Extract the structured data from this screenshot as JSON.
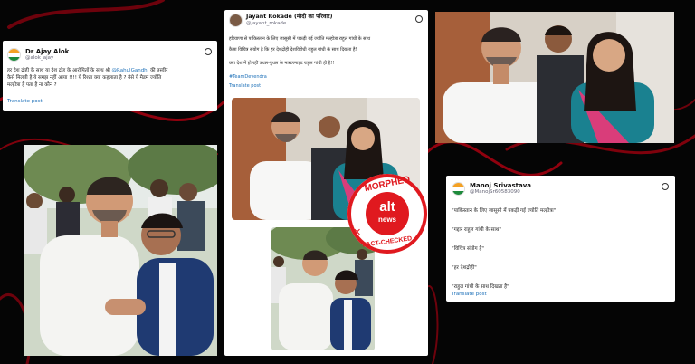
{
  "colors": {
    "background": "#050505",
    "swirl": "#b30010",
    "link": "#1d70b8",
    "stamp_red": "#e0191f",
    "saffron": "#f4a124",
    "india_green": "#1e8a3c"
  },
  "tweet_alok": {
    "name": "Dr Ajay Alok",
    "handle": "@alok_ajay",
    "text_line1_before": "हर देश द्रोही के साथ या देश द्रोह के आरोपितों के साथ श्री ",
    "mention": "@RahulGandhi",
    "text_line1_after": " की तस्वीर",
    "text_line2": "कैसे मिलती है ये समझ नहीं आया !!!! ये रिश्ता क्या कहलाता है ? वैसे ये मैडम ज्योति",
    "text_line3": "मल्होत्रा है पता है ना कौन ?",
    "translate": "Translate post",
    "icon": "x-logo-icon"
  },
  "tweet_jayant": {
    "name": "Jayant Rokade (मोदी का परिवार)",
    "handle": "@jayant_rokade",
    "line1": "हरियाणा से पाकिस्तान के लिए जासूसी में पकड़ी गई ज्योति मल्होत्रा राहुल गांधी के साथ",
    "line2": "कैसा विचित्र संयोग है कि हर देशद्रोही देशविरोधी राहुल गांधी के साथ दिखता है!",
    "line3": "क्या देश में हो रहीं उथल-पुथल के मास्टरमाइंड राहुल गांधी ही है!!",
    "hashtag": "#TeamDevendra",
    "translate": "Translate post",
    "icon": "x-logo-icon"
  },
  "tweet_manoj": {
    "name": "Manoj Srivastava",
    "handle": "@ManojSr60583090",
    "quotes": [
      "\"पाकिस्तान के लिए जासूसी में पकड़ी गई ज्योति मल्होत्रा\"",
      "\"गद्दार राहुल गांधी के साथ\"",
      "\"विचित्र संयोग है\"",
      "\"हर देशद्रोही\"",
      "\"राहुल गांधी के साथ दिखता है\""
    ],
    "translate": "Translate post",
    "icon": "x-logo-icon"
  },
  "stamp": {
    "top": "MORPHED",
    "brand_top": "alt",
    "brand_bottom": "news",
    "bottom": "FACT-CHECKED",
    "icon": "cross-icon"
  }
}
